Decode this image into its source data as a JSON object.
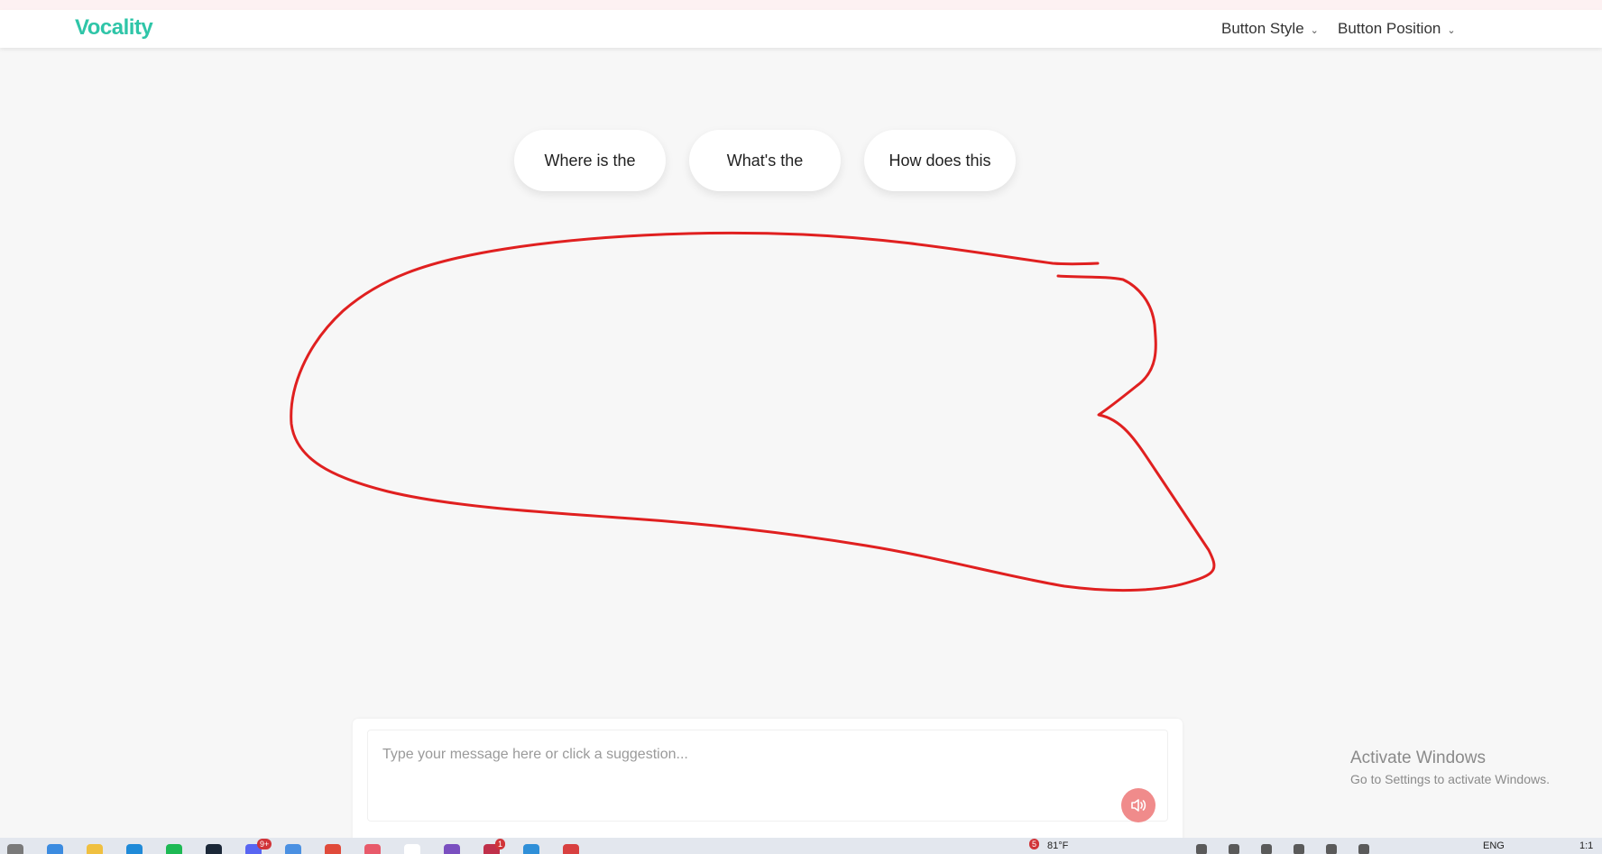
{
  "app": {
    "logo_text": "Vocality",
    "accent_color": "#2fc5a8"
  },
  "nav": {
    "menus": [
      {
        "label": "Button Style",
        "icon": "chevron-down-icon"
      },
      {
        "label": "Button Position",
        "icon": "chevron-down-icon"
      }
    ]
  },
  "suggestions": [
    "Where is the",
    "What's the",
    "How does this"
  ],
  "composer": {
    "placeholder": "Type your message here or click a suggestion...",
    "value": "",
    "speak_button_icon": "speaker-icon",
    "speak_button_color": "#f08b8b"
  },
  "annotation": {
    "color": "#e02020",
    "shape": "hand-drawn outline"
  },
  "watermark": {
    "title": "Activate Windows",
    "subtitle": "Go to Settings to activate Windows."
  },
  "taskbar": {
    "badges": [
      "9+",
      "1"
    ],
    "weather_badge": "5",
    "weather": "81°F",
    "lang": "ENG",
    "clock": "1:1"
  }
}
